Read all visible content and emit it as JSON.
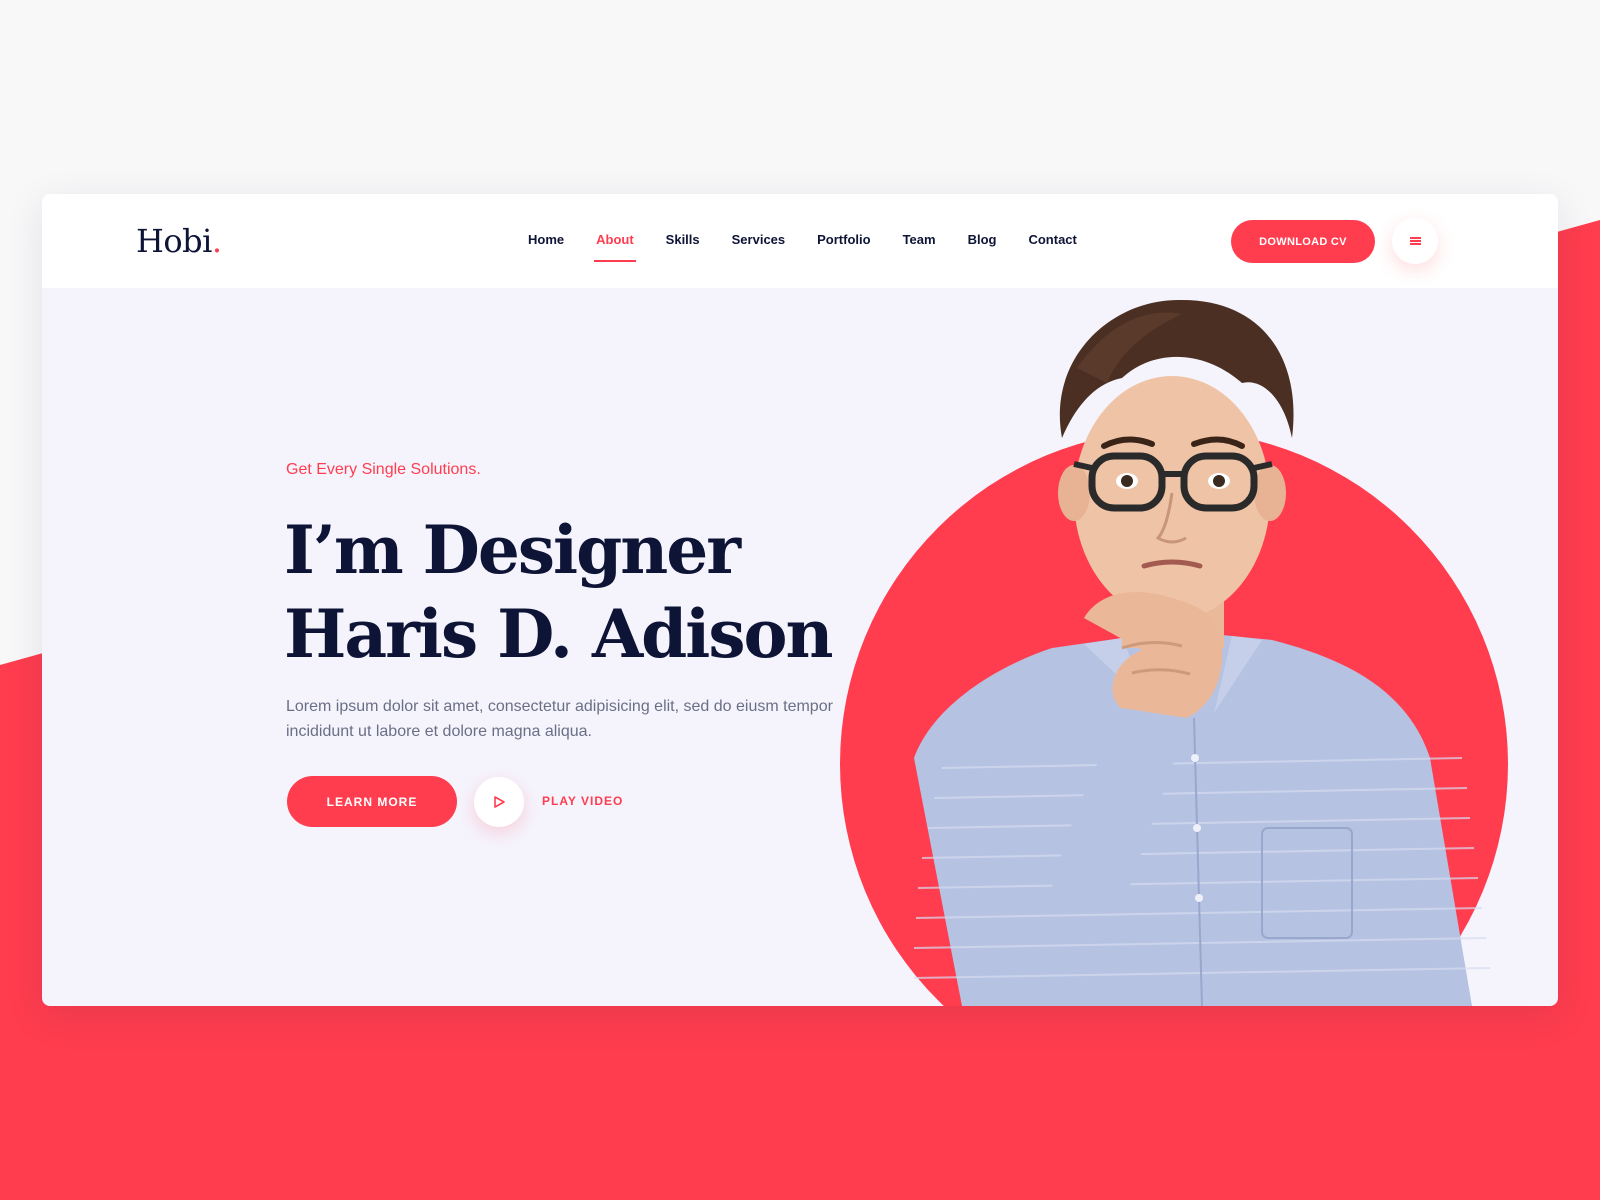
{
  "colors": {
    "accent": "#ff3d4f",
    "navy": "#0e1436",
    "hero_background": "#f5f4fd",
    "page_background": "#f8f8f9"
  },
  "brand": {
    "name": "Hobi",
    "dot": "."
  },
  "nav": {
    "items": [
      {
        "label": "Home",
        "active": false
      },
      {
        "label": "About",
        "active": true
      },
      {
        "label": "Skills",
        "active": false
      },
      {
        "label": "Services",
        "active": false
      },
      {
        "label": "Portfolio",
        "active": false
      },
      {
        "label": "Team",
        "active": false
      },
      {
        "label": "Blog",
        "active": false
      },
      {
        "label": "Contact",
        "active": false
      }
    ]
  },
  "header": {
    "download_label": "DOWNLOAD CV",
    "menu_icon": "hamburger-icon"
  },
  "hero": {
    "subtitle": "Get Every Single Solutions.",
    "headline_line1": "I’m Designer",
    "headline_line2": "Haris D. Adison",
    "description": "Lorem ipsum dolor sit amet, consectetur adipisicing elit, sed do eiusm tempor incididunt ut labore et dolore magna aliqua.",
    "learn_more_label": "LEARN MORE",
    "play_icon": "play-icon",
    "play_video_label": "PLAY VIDEO",
    "portrait": "man-with-glasses-thinking-photo"
  }
}
